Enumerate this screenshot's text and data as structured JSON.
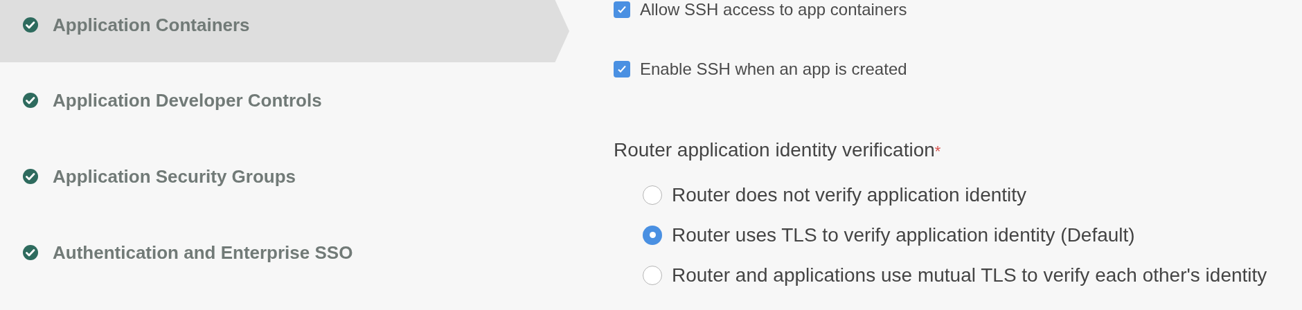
{
  "sidebar": {
    "items": [
      {
        "label": "Application Containers",
        "selected": true,
        "completed": true
      },
      {
        "label": "Application Developer Controls",
        "selected": false,
        "completed": true
      },
      {
        "label": "Application Security Groups",
        "selected": false,
        "completed": true
      },
      {
        "label": "Authentication and Enterprise SSO",
        "selected": false,
        "completed": true
      }
    ]
  },
  "form": {
    "checkboxes": [
      {
        "label": "Allow SSH access to app containers",
        "checked": true
      },
      {
        "label": "Enable SSH when an app is created",
        "checked": true
      }
    ],
    "radio_group": {
      "label": "Router application identity verification",
      "required_mark": "*",
      "options": [
        {
          "label": "Router does not verify application identity",
          "selected": false
        },
        {
          "label": "Router uses TLS to verify application identity (Default)",
          "selected": true
        },
        {
          "label": "Router and applications use mutual TLS to verify each other's identity",
          "selected": false
        }
      ]
    }
  }
}
